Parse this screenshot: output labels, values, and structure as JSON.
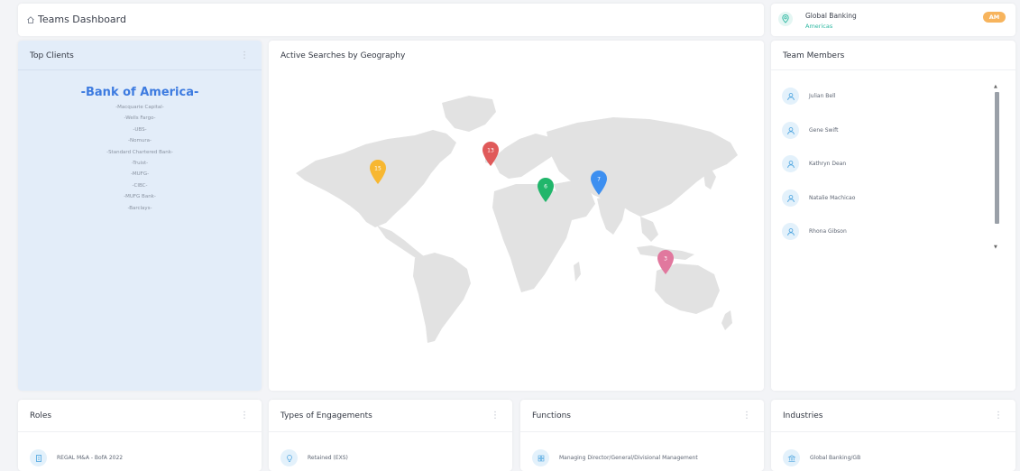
{
  "header": {
    "title": "Teams Dashboard",
    "icon": "home-icon"
  },
  "organization": {
    "name": "Global Banking",
    "region": "Americas",
    "badge": "AM",
    "icon": "location-pin-icon"
  },
  "top_clients": {
    "title": "Top Clients",
    "highlight": "-Bank of America-",
    "items": [
      "-Macquarie Capital-",
      "-Wells Fargo-",
      "-UBS-",
      "-Nomura-",
      "-Standard Chartered Bank-",
      "-Truist-",
      "-MUFG-",
      "-CIBC-",
      "-MUFG Bank-",
      "-Barclays-"
    ]
  },
  "geography": {
    "title": "Active Searches by Geography",
    "markers": [
      {
        "region": "North America",
        "count": "15",
        "color": "#f7b731"
      },
      {
        "region": "Europe",
        "count": "13",
        "color": "#e05a5a"
      },
      {
        "region": "Middle East",
        "count": "6",
        "color": "#21b66b"
      },
      {
        "region": "Asia",
        "count": "7",
        "color": "#3d8ff0"
      },
      {
        "region": "Australia",
        "count": "3",
        "color": "#e1789e"
      }
    ]
  },
  "team_members": {
    "title": "Team Members",
    "members": [
      "Julian Bell",
      "Gene Swift",
      "Kathryn Dean",
      "Natalie Machicao",
      "Rhona Gibson"
    ]
  },
  "roles": {
    "title": "Roles",
    "first_item": "REGAL M&A - BofA 2022"
  },
  "engagements": {
    "title": "Types of Engagements",
    "first_item": "Retained (EXS)"
  },
  "functions": {
    "title": "Functions",
    "first_item": "Managing Director/General/Divisional Management"
  },
  "industries": {
    "title": "Industries",
    "first_item": "Global Banking/GB"
  },
  "colors": {
    "accent": "#3d7be0",
    "teal": "#2fb8a2",
    "badge": "#f7b45d",
    "client_panel": "#e3edf9"
  }
}
